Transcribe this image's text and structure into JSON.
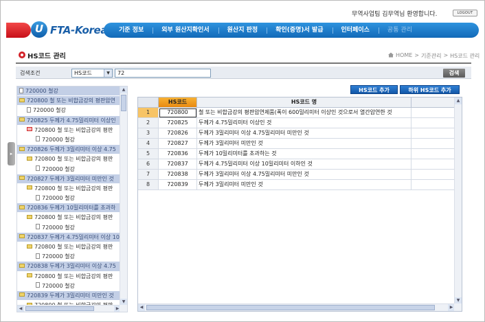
{
  "header": {
    "greeting": "무역사업팀 김무역님 환영합니다.",
    "logout_label": "LOGOUT",
    "logo_text": "FTA-Korea",
    "logo_letter": "U"
  },
  "nav": {
    "items": [
      {
        "label": "기준 정보"
      },
      {
        "label": "외부 원산지확인서"
      },
      {
        "label": "원산지 판정"
      },
      {
        "label": "확인(증명)서 발급"
      },
      {
        "label": "인터페이스"
      },
      {
        "label": "공통 관리"
      }
    ]
  },
  "page": {
    "title": "HS코드 관리",
    "breadcrumb": [
      "HOME",
      ">",
      "기준관리",
      ">",
      "HS코드 관리"
    ]
  },
  "search": {
    "label": "검색조건",
    "select_value": "HS코드",
    "input_value": "72",
    "button_label": "검색"
  },
  "tree": {
    "nodes": [
      {
        "level": 0,
        "icon": "doc",
        "label": "720000 철강"
      },
      {
        "level": 0,
        "icon": "folder",
        "label": "720800 철 또는 비합금강의 평판압연"
      },
      {
        "level": 1,
        "icon": "doc",
        "label": "720000 철강"
      },
      {
        "level": 0,
        "icon": "folder",
        "label": "720825 두께가 4.75밀리미터 이상인"
      },
      {
        "level": 1,
        "icon": "redfolder",
        "label": "720800 철 또는 비합금강의 평판"
      },
      {
        "level": 2,
        "icon": "doc",
        "label": "720000 철강"
      },
      {
        "level": 0,
        "icon": "folder",
        "label": "720826 두께가 3밀리미터 이상 4.75"
      },
      {
        "level": 1,
        "icon": "folder",
        "label": "720800 철 또는 비합금강의 평판"
      },
      {
        "level": 2,
        "icon": "doc",
        "label": "720000 철강"
      },
      {
        "level": 0,
        "icon": "folder",
        "label": "720827 두께가 3밀리미터 미만인 것"
      },
      {
        "level": 1,
        "icon": "folder",
        "label": "720800 철 또는 비합금강의 평판"
      },
      {
        "level": 2,
        "icon": "doc",
        "label": "720000 철강"
      },
      {
        "level": 0,
        "icon": "folder",
        "label": "720836 두께가 10밀리미터를 초과하"
      },
      {
        "level": 1,
        "icon": "folder",
        "label": "720800 철 또는 비합금강의 평판"
      },
      {
        "level": 2,
        "icon": "doc",
        "label": "720000 철강"
      },
      {
        "level": 0,
        "icon": "folder",
        "label": "720837 두께가 4.75밀리미터 이상 10"
      },
      {
        "level": 1,
        "icon": "folder",
        "label": "720800 철 또는 비합금강의 평판"
      },
      {
        "level": 2,
        "icon": "doc",
        "label": "720000 철강"
      },
      {
        "level": 0,
        "icon": "folder",
        "label": "720838 두께가 3밀리미터 이상 4.75"
      },
      {
        "level": 1,
        "icon": "folder",
        "label": "720800 철 또는 비합금강의 평판"
      },
      {
        "level": 2,
        "icon": "doc",
        "label": "720000 철강"
      },
      {
        "level": 0,
        "icon": "folder",
        "label": "720839 두께가 3밀리미터 미만인 것"
      },
      {
        "level": 1,
        "icon": "folder",
        "label": "720800 철 또는 비합금강의 평판"
      }
    ]
  },
  "actions": {
    "add_hs": "HS코드 추가",
    "add_sub_hs": "하위 HS코드 추가"
  },
  "grid": {
    "headers": {
      "code": "HS코드",
      "name": "HS코드 명"
    },
    "selected_row": 1,
    "rows": [
      {
        "num": "1",
        "code": "720800",
        "name": "철 또는 비합금강의 평판압연제품(폭이 600밀리미터 이상인 것으로서 열간압연한 것"
      },
      {
        "num": "2",
        "code": "720825",
        "name": "두께가 4.75밀리미터 이상인 것"
      },
      {
        "num": "3",
        "code": "720826",
        "name": "두께가 3밀리미터 이상 4.75밀리미터 미만인 것"
      },
      {
        "num": "4",
        "code": "720827",
        "name": "두께가 3밀리미터 미만인 것"
      },
      {
        "num": "5",
        "code": "720836",
        "name": "두께가 10밀리미터를 초과하는 것"
      },
      {
        "num": "6",
        "code": "720837",
        "name": "두께가 4.75밀리미터 이상 10밀리미터 이하인 것"
      },
      {
        "num": "7",
        "code": "720838",
        "name": "두께가 3밀리미터 이상 4.75밀리미터 미만인 것"
      },
      {
        "num": "8",
        "code": "720839",
        "name": "두께가 3밀리미터 미만인 것"
      }
    ]
  }
}
